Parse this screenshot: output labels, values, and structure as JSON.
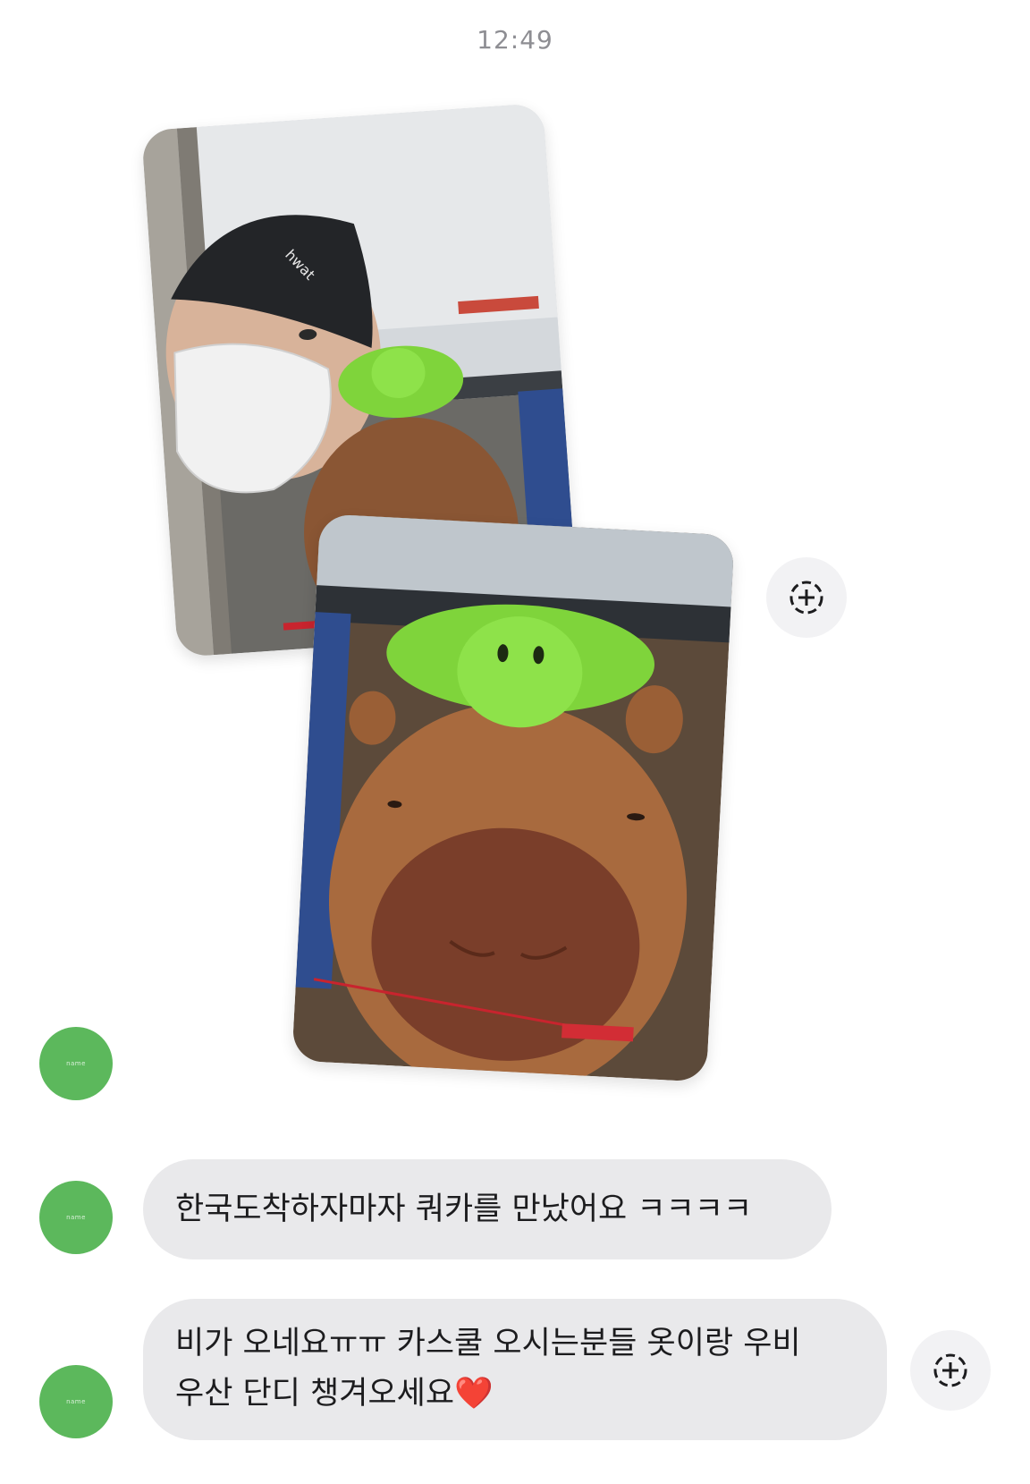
{
  "header": {
    "time": "12:49"
  },
  "photos": [
    {
      "description": "selfie on a bus with capybara and turtle plush toys"
    },
    {
      "description": "capybara plush with turtle plush on its head"
    }
  ],
  "avatars": [
    {
      "label": "name"
    },
    {
      "label": "name"
    },
    {
      "label": "name"
    }
  ],
  "messages": [
    {
      "lines": [
        "한국도착하자마자 쿼카를 만났어요 ㅋㅋㅋㅋ"
      ]
    },
    {
      "lines": [
        "비가 오네요ㅠㅠ 카스쿨 오시는분들 옷이랑 우비",
        "우산 단디 챙겨오세요"
      ],
      "emoji": "❤️"
    }
  ],
  "reaction": {
    "icon": "add-reaction-icon"
  },
  "colors": {
    "avatar": "#5cb85c",
    "bubble": "#e9e9eb",
    "background": "#ffffff"
  }
}
